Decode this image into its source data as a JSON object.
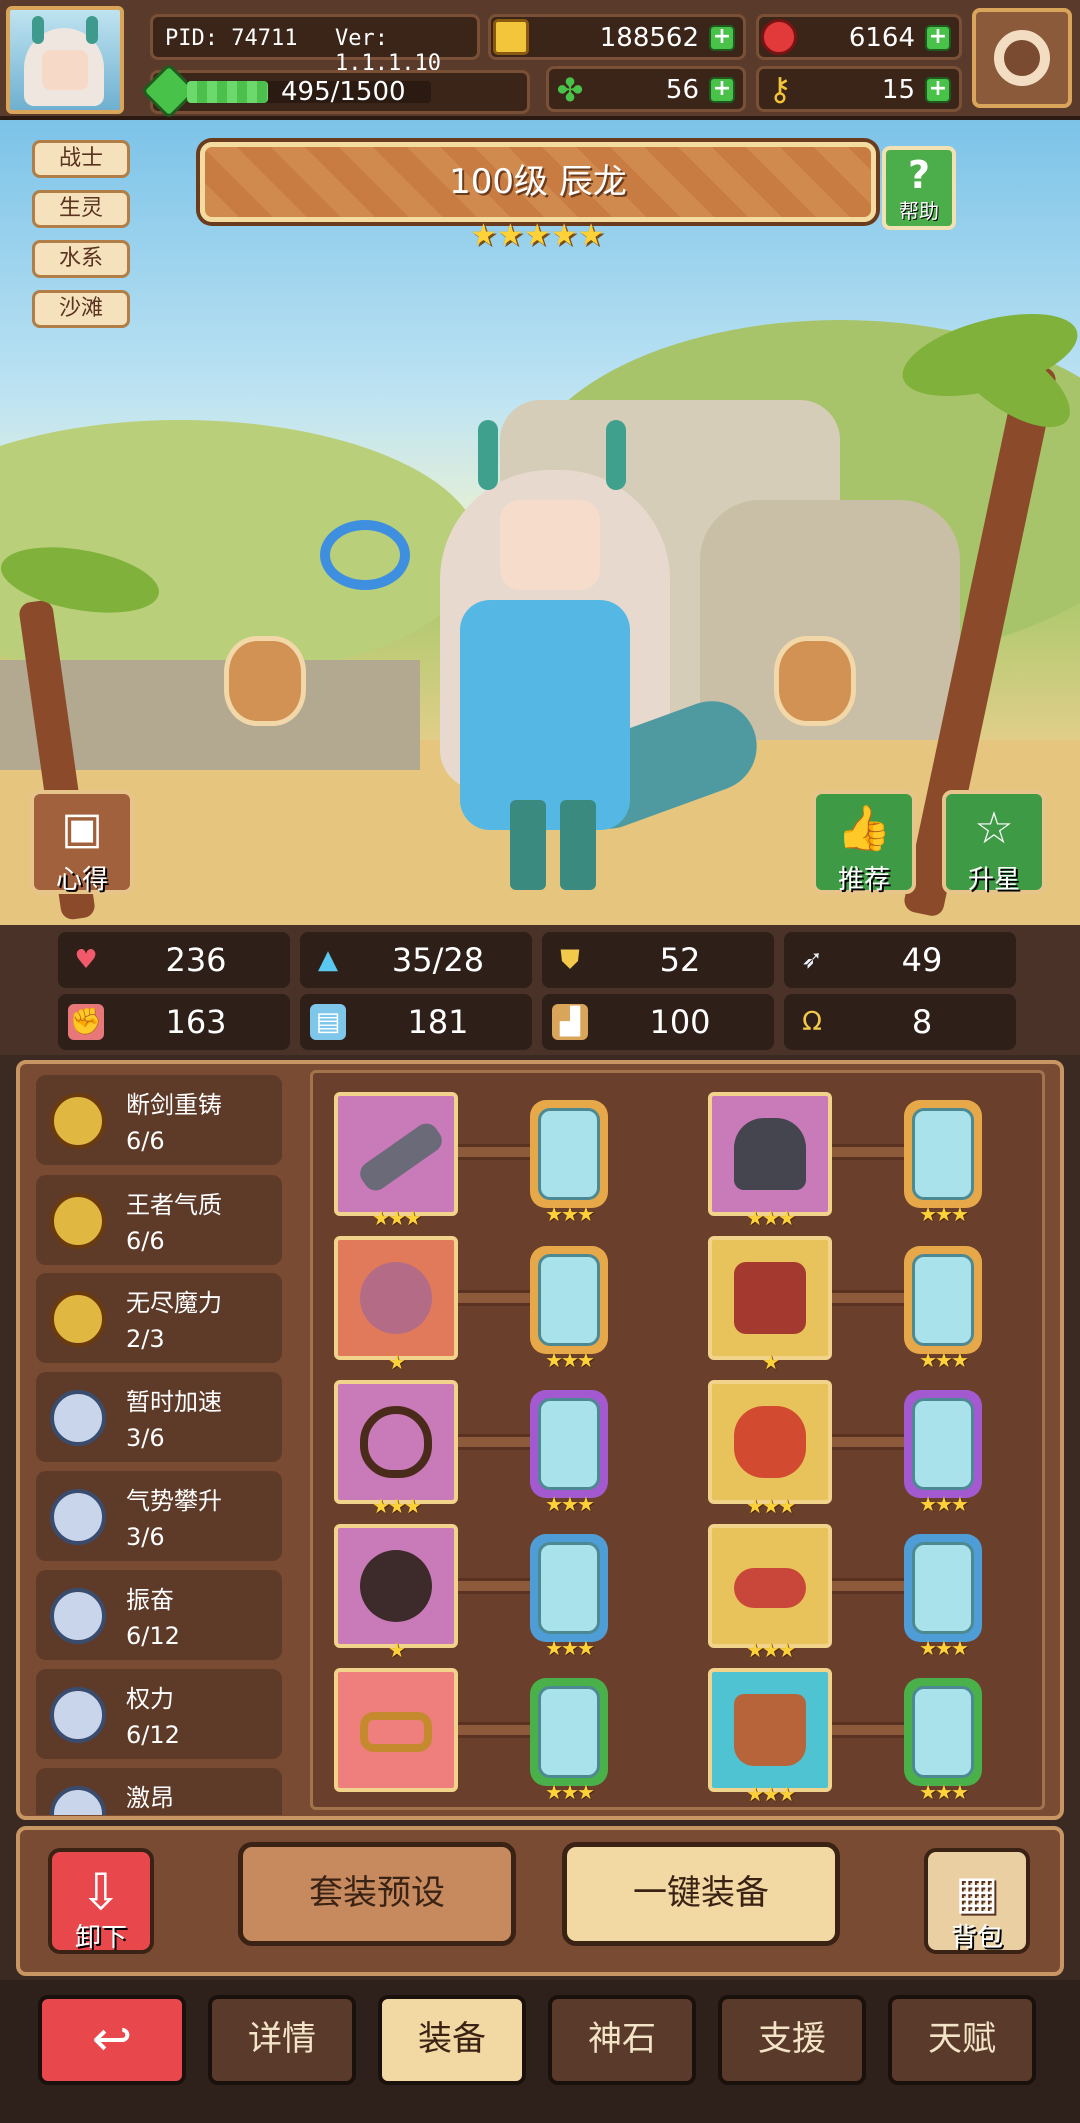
{
  "header": {
    "pid": "PID: 74711",
    "version": "Ver: 1.1.1.10",
    "gold": "188562",
    "gems": "6164",
    "exp": "495/1500",
    "exp_fraction": 0.33,
    "clover": "56",
    "key": "15"
  },
  "hero": {
    "title": "100级 辰龙",
    "stars": "★★★★★",
    "help_label": "帮助",
    "tags": [
      "战士",
      "生灵",
      "水系",
      "沙滩"
    ],
    "insight_label": "心得",
    "recommend_label": "推荐",
    "starup_label": "升星"
  },
  "stats": {
    "hp": "236",
    "mana": "35/28",
    "defense": "52",
    "speed": "49",
    "attack": "163",
    "magic": "181",
    "accuracy": "100",
    "luck": "8"
  },
  "sets": [
    {
      "name": "断剑重铸",
      "count": "6/6"
    },
    {
      "name": "王者气质",
      "count": "6/6"
    },
    {
      "name": "无尽魔力",
      "count": "2/3"
    },
    {
      "name": "暂时加速",
      "count": "3/6"
    },
    {
      "name": "气势攀升",
      "count": "3/6"
    },
    {
      "name": "振奋",
      "count": "6/12"
    },
    {
      "name": "权力",
      "count": "6/12"
    },
    {
      "name": "激昂",
      "count": ""
    }
  ],
  "equipment": [
    {
      "item_stars": "★★★",
      "gem_stars": "★★★"
    },
    {
      "item_stars": "★★★",
      "gem_stars": "★★★"
    },
    {
      "item_stars": "★",
      "gem_stars": "★★★"
    },
    {
      "item_stars": "★",
      "gem_stars": "★★★"
    },
    {
      "item_stars": "★★★",
      "gem_stars": "★★★"
    },
    {
      "item_stars": "★★★",
      "gem_stars": "★★★"
    },
    {
      "item_stars": "★",
      "gem_stars": "★★★"
    },
    {
      "item_stars": "★★★",
      "gem_stars": "★★★"
    },
    {
      "item_stars": "",
      "gem_stars": "★★★"
    },
    {
      "item_stars": "★★★",
      "gem_stars": "★★★"
    }
  ],
  "actions": {
    "unequip_label": "卸下",
    "preset_label": "套装预设",
    "auto_equip_label": "一键装备",
    "bag_label": "背包"
  },
  "nav": {
    "tabs": [
      "详情",
      "装备",
      "神石",
      "支援",
      "天赋"
    ],
    "active": "装备"
  },
  "colors": {
    "accent_green": "#49c24a",
    "frame_gold": "#f2d38c",
    "back_red": "#e8474b"
  }
}
